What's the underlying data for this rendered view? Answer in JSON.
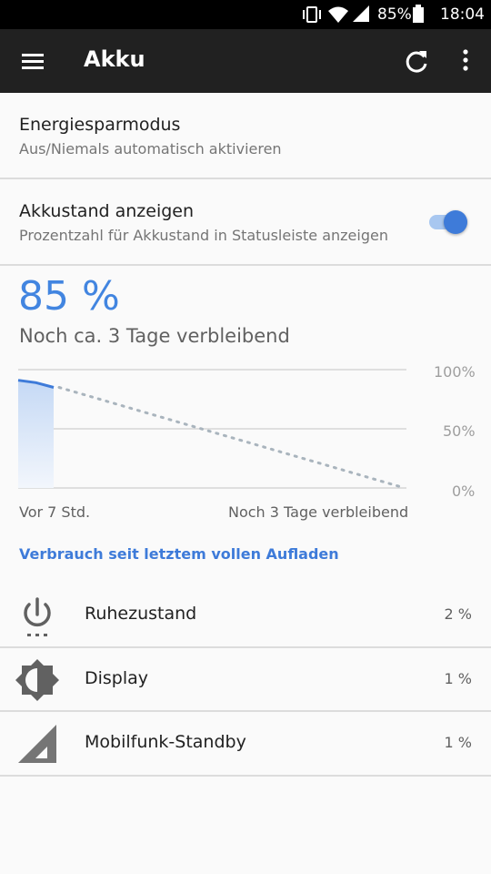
{
  "status_bar": {
    "battery_percent": "85%",
    "time": "18:04",
    "icons": [
      "vibrate-icon",
      "wifi-icon",
      "cell-signal-icon",
      "battery-icon"
    ]
  },
  "app_bar": {
    "title": "Akku",
    "icons": [
      "menu-icon",
      "refresh-icon",
      "more-vert-icon"
    ]
  },
  "settings": {
    "saver": {
      "title": "Energiesparmodus",
      "subtitle": "Aus/Niemals automatisch aktivieren"
    },
    "show_percent": {
      "title": "Akkustand anzeigen",
      "subtitle": "Prozentzahl für Akkustand in Statusleiste anzeigen",
      "enabled": true
    }
  },
  "battery": {
    "level": "85 %",
    "remaining": "Noch ca. 3 Tage verbleibend"
  },
  "chart_data": {
    "type": "line",
    "y_ticks": [
      "100%",
      "50%",
      "0%"
    ],
    "ylim": [
      0,
      100
    ],
    "x_labels": [
      "Vor 7 Std.",
      "Noch 3 Tage verbleibend"
    ],
    "series": [
      {
        "kind": "history",
        "values": [
          {
            "x": 0,
            "y": 91
          },
          {
            "x": 0.5,
            "y": 89
          },
          {
            "x": 1,
            "y": 85
          }
        ]
      },
      {
        "kind": "projection",
        "values": [
          {
            "x": 0,
            "y": 85
          },
          {
            "x": 1,
            "y": 0
          }
        ]
      }
    ],
    "colors": {
      "line": "#3e7bd9",
      "fill": "#c5d9f5",
      "projection": "#a9b4bd",
      "grid": "#d6d6d6"
    }
  },
  "usage": {
    "header": "Verbrauch seit letztem vollen Aufladen",
    "items": [
      {
        "label": "Ruhezustand",
        "percent": "2 %",
        "icon": "power-icon"
      },
      {
        "label": "Display",
        "percent": "1 %",
        "icon": "brightness-icon"
      },
      {
        "label": "Mobilfunk-Standby",
        "percent": "1 %",
        "icon": "cell-signal-icon"
      }
    ]
  },
  "colors": {
    "accent": "#3e7bd9",
    "appbar": "#212121",
    "background": "#fafafa"
  }
}
